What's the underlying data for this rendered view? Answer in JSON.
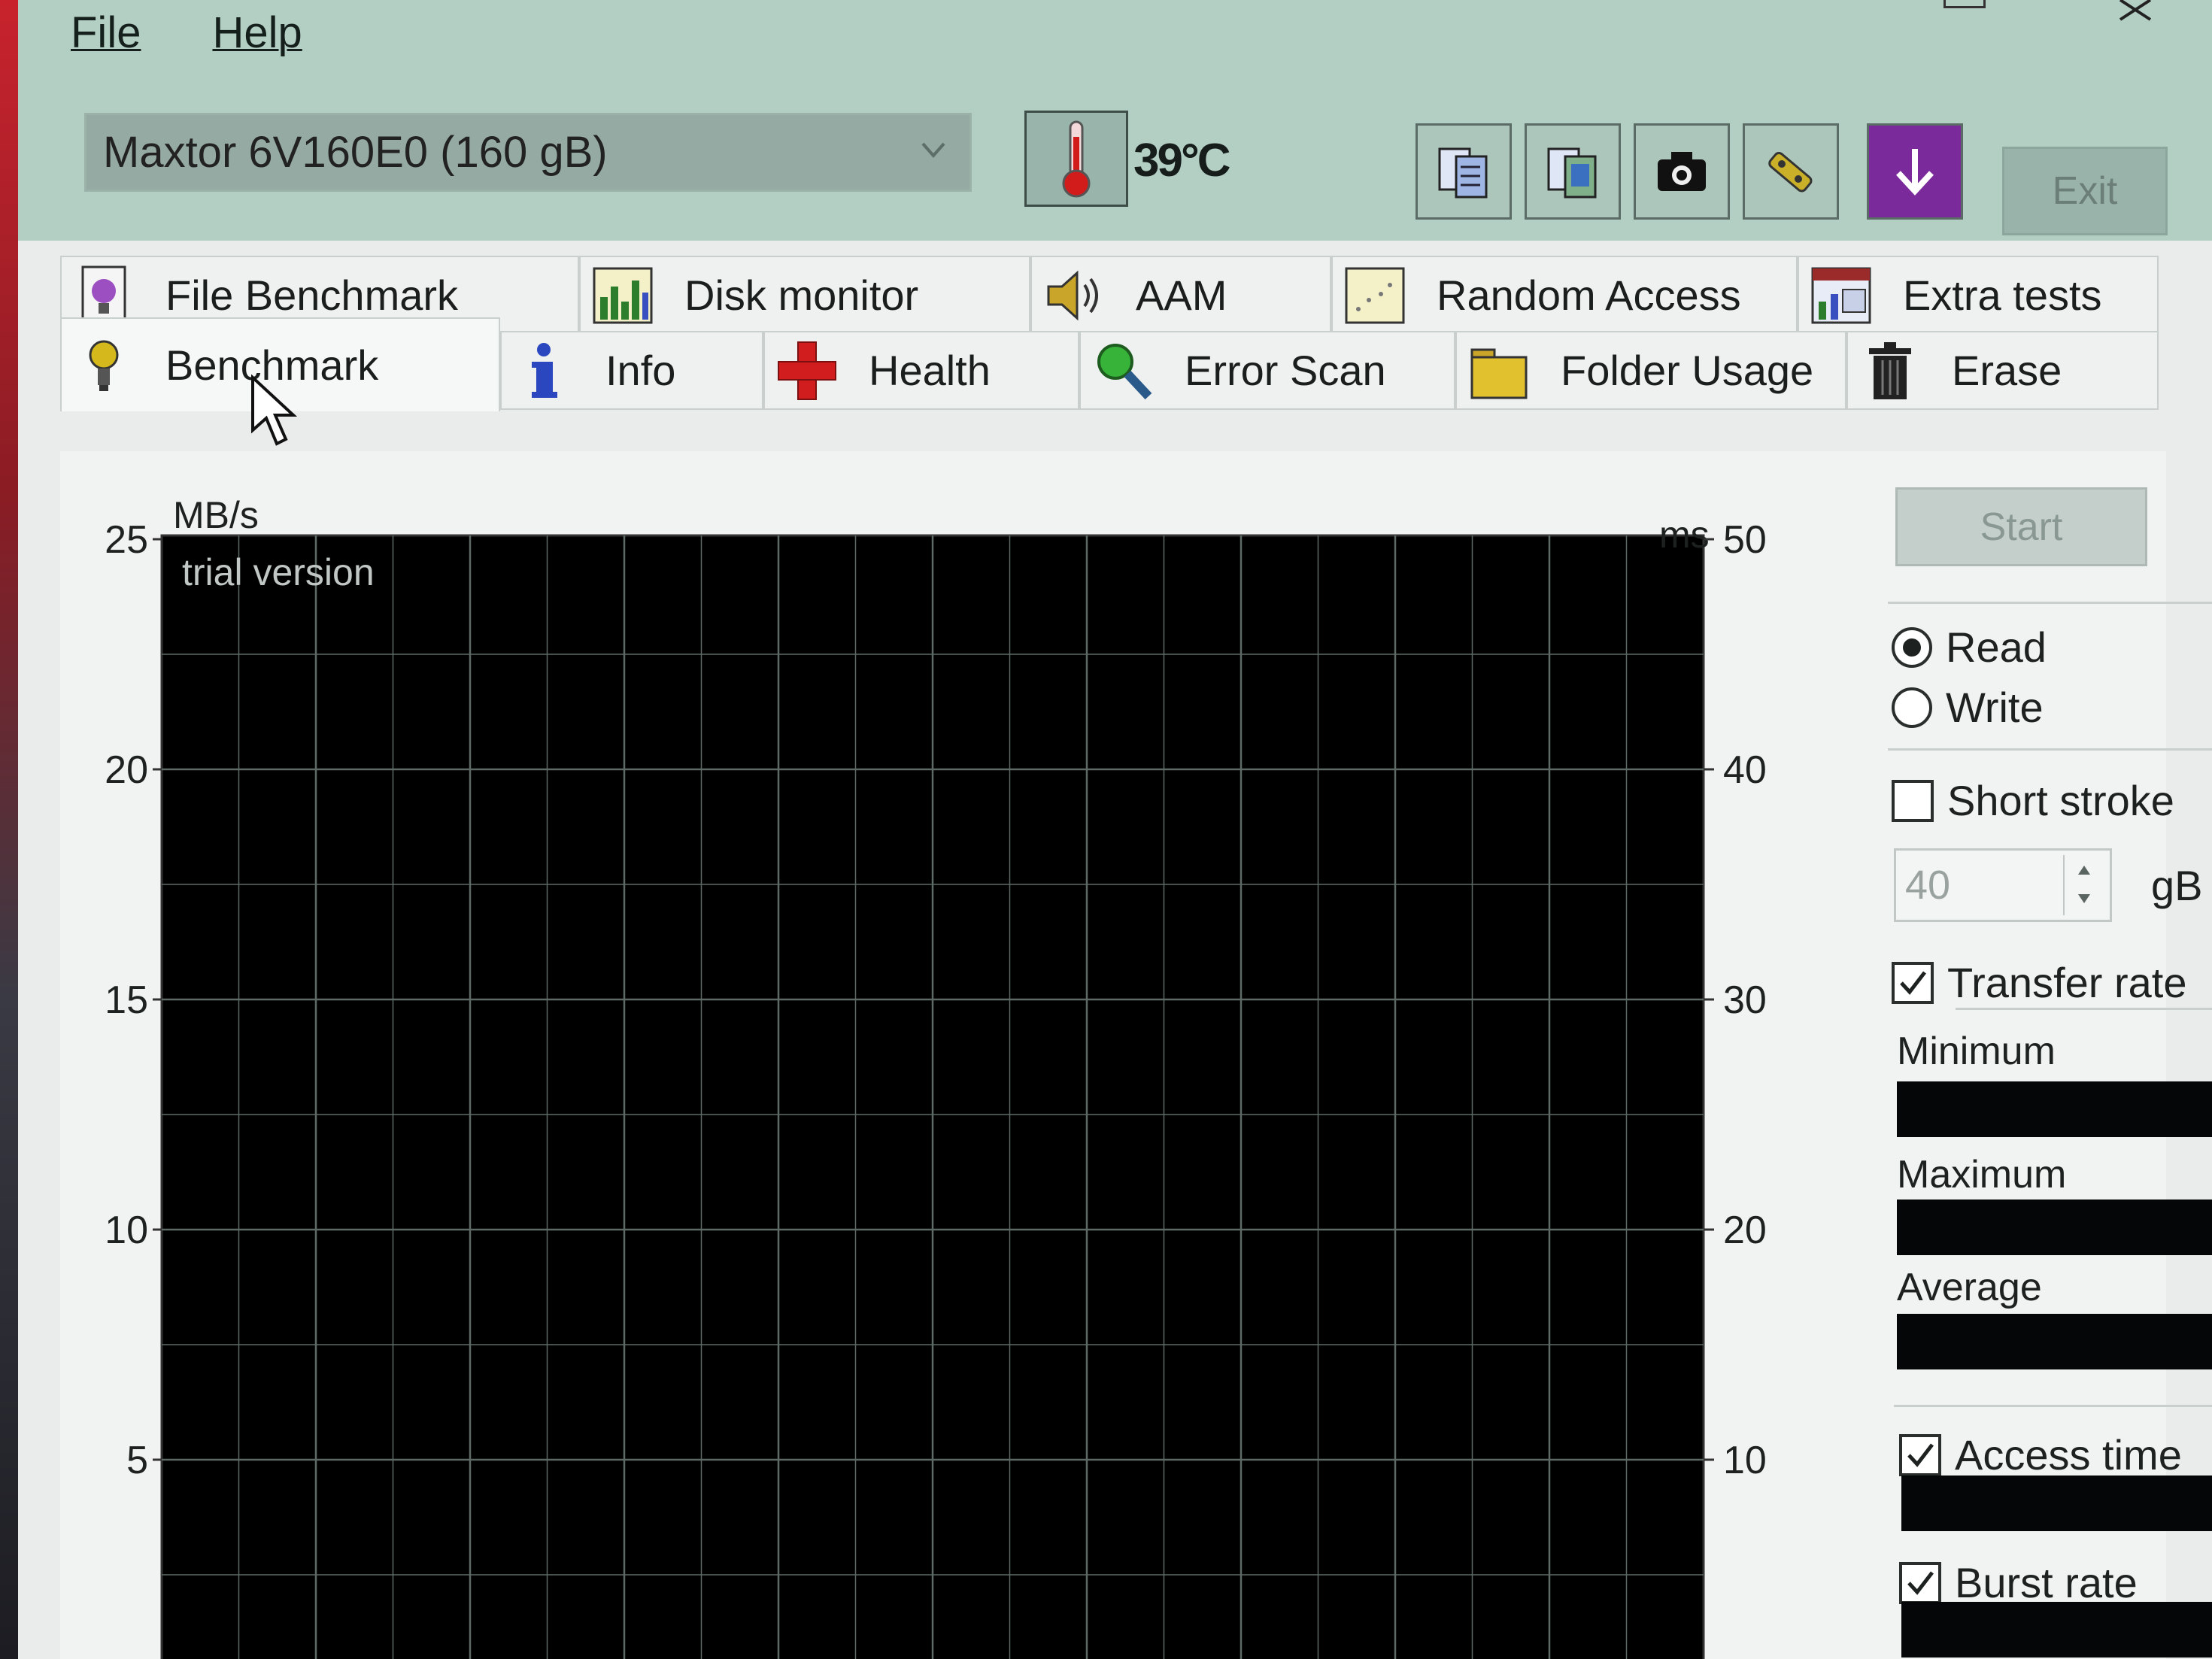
{
  "menu": {
    "file": "File",
    "help": "Help"
  },
  "toolbar": {
    "drive": "Maxtor 6V160E0 (160 gB)",
    "temperature": "39°C",
    "exit_label": "Exit"
  },
  "tabs_row1": [
    {
      "label": "File Benchmark",
      "icon": "file-benchmark-icon"
    },
    {
      "label": "Disk monitor",
      "icon": "disk-monitor-icon"
    },
    {
      "label": "AAM",
      "icon": "speaker-icon"
    },
    {
      "label": "Random Access",
      "icon": "random-access-icon"
    },
    {
      "label": "Extra tests",
      "icon": "extra-tests-icon"
    }
  ],
  "tabs_row2": [
    {
      "label": "Benchmark",
      "icon": "benchmark-icon"
    },
    {
      "label": "Info",
      "icon": "info-icon"
    },
    {
      "label": "Health",
      "icon": "health-cross-icon"
    },
    {
      "label": "Error Scan",
      "icon": "magnifier-icon"
    },
    {
      "label": "Folder Usage",
      "icon": "folder-icon"
    },
    {
      "label": "Erase",
      "icon": "trash-icon"
    }
  ],
  "chart": {
    "left_unit": "MB/s",
    "right_unit": "ms",
    "watermark": "trial version",
    "left_ticks": [
      "25",
      "20",
      "15",
      "10",
      "5"
    ],
    "right_ticks": [
      "50",
      "40",
      "30",
      "20",
      "10"
    ]
  },
  "chart_data": {
    "type": "line",
    "series": [],
    "ylabel": "MB/s",
    "y2label": "ms",
    "ylim": [
      0,
      25
    ],
    "y2lim": [
      0,
      50
    ],
    "grid": true,
    "background": "#000000"
  },
  "panel": {
    "start_label": "Start",
    "read_label": "Read",
    "write_label": "Write",
    "short_stroke_label": "Short stroke",
    "short_stroke_value": "40",
    "unit": "gB",
    "transfer_rate_label": "Transfer rate",
    "minimum_label": "Minimum",
    "maximum_label": "Maximum",
    "average_label": "Average",
    "access_time_label": "Access time",
    "burst_rate_label": "Burst rate"
  }
}
